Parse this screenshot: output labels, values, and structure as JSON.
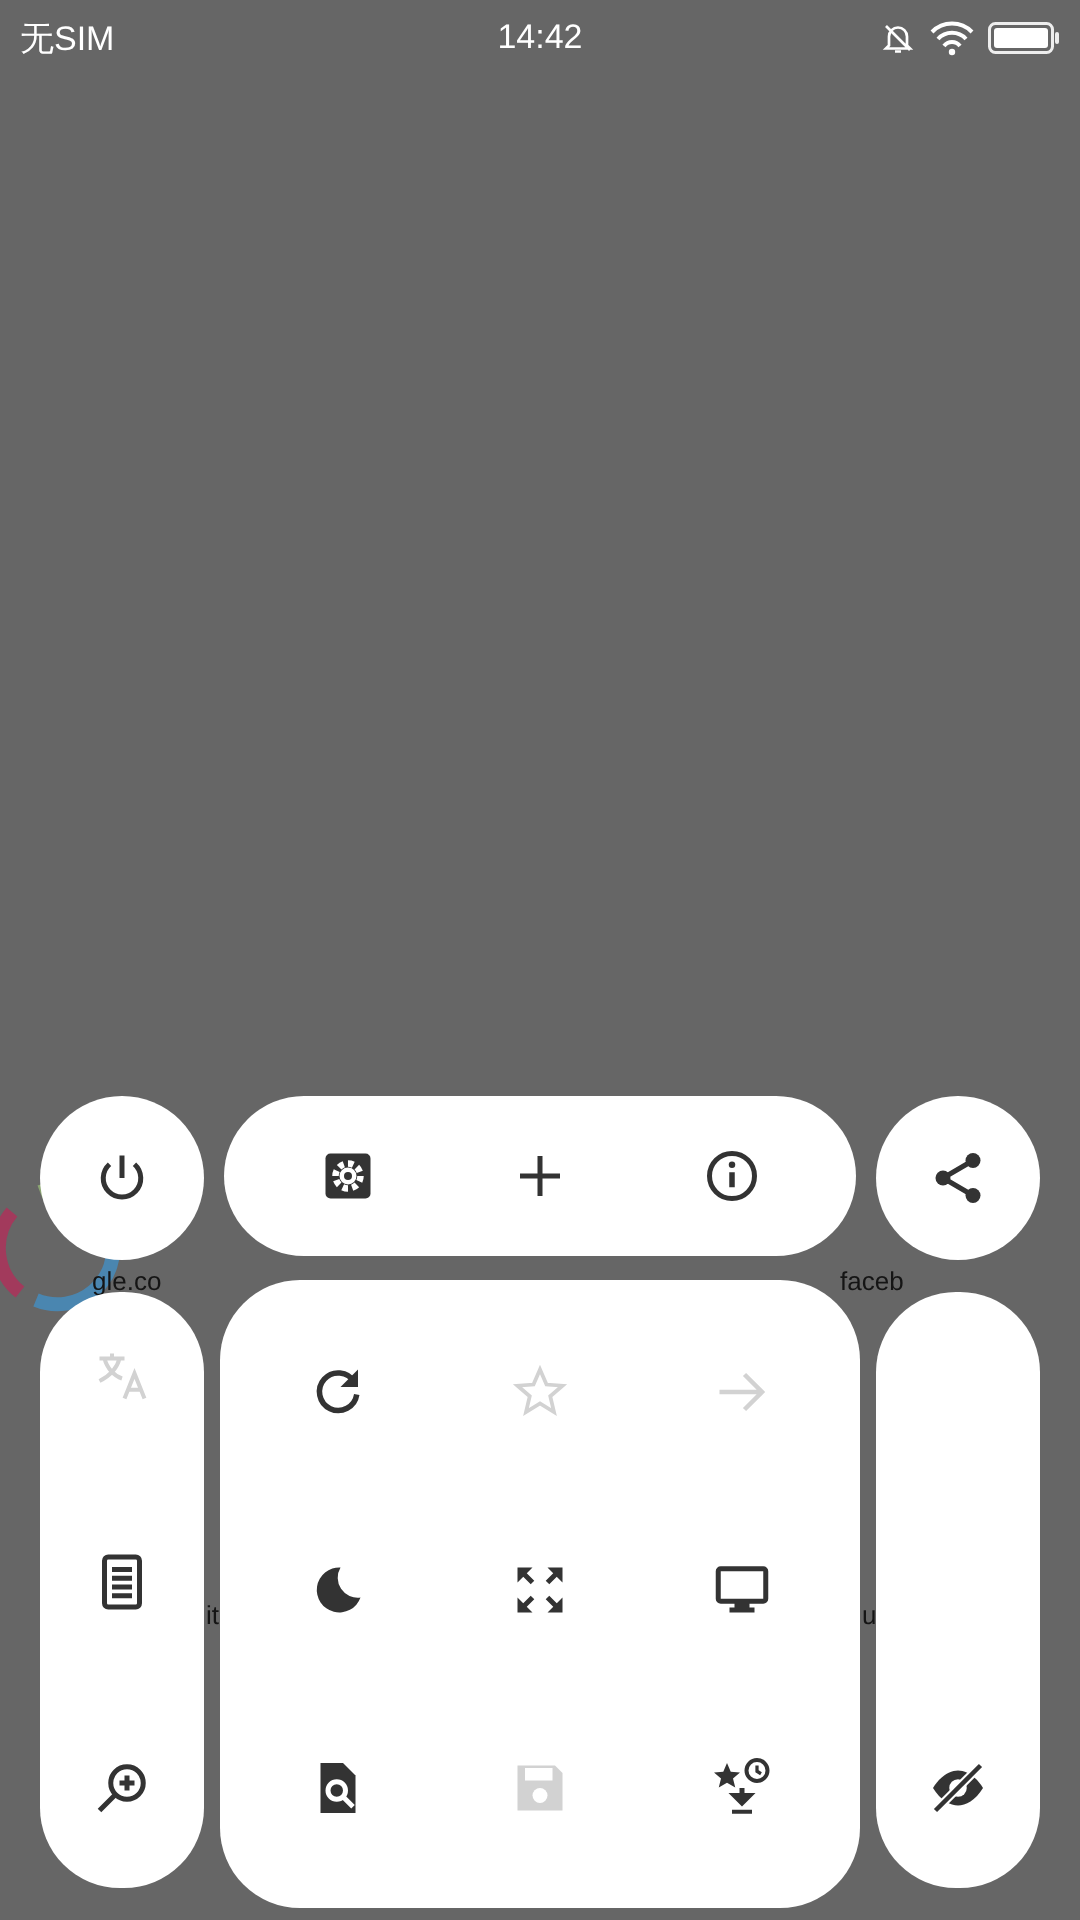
{
  "status_bar": {
    "carrier": "无SIM",
    "time": "14:42"
  },
  "background": {
    "labels": [
      "gle.co",
      "faceb",
      "it",
      "u"
    ]
  },
  "menu": {
    "left_button": {
      "kind": "power",
      "disabled": false
    },
    "top_bar": [
      {
        "kind": "settings",
        "disabled": false
      },
      {
        "kind": "add",
        "disabled": false
      },
      {
        "kind": "info",
        "disabled": false
      }
    ],
    "right_button": {
      "kind": "share",
      "disabled": false
    },
    "left_column": [
      {
        "kind": "translate",
        "disabled": true
      },
      {
        "kind": "reader",
        "disabled": false
      },
      {
        "kind": "zoom",
        "disabled": false
      }
    ],
    "grid": [
      {
        "kind": "reload",
        "disabled": false
      },
      {
        "kind": "bookmark",
        "disabled": true
      },
      {
        "kind": "forward",
        "disabled": true
      },
      {
        "kind": "night",
        "disabled": false
      },
      {
        "kind": "fullscreen",
        "disabled": false
      },
      {
        "kind": "desktop",
        "disabled": false
      },
      {
        "kind": "find",
        "disabled": false
      },
      {
        "kind": "save",
        "disabled": true
      },
      {
        "kind": "library",
        "disabled": false
      }
    ],
    "right_column": [
      {
        "kind": "hide",
        "disabled": false
      }
    ]
  }
}
